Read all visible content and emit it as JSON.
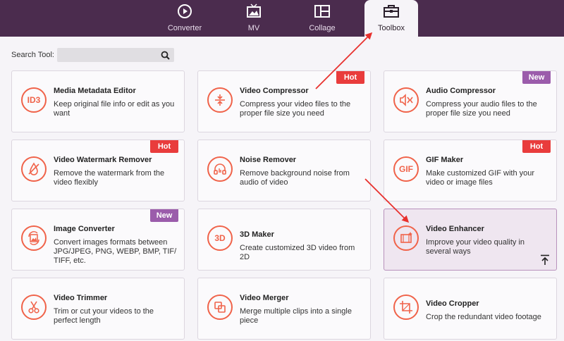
{
  "nav": {
    "tabs": [
      {
        "label": "Converter",
        "icon": "play-circle-icon"
      },
      {
        "label": "MV",
        "icon": "tv-image-icon"
      },
      {
        "label": "Collage",
        "icon": "collage-layout-icon"
      },
      {
        "label": "Toolbox",
        "icon": "toolbox-icon",
        "active": true
      }
    ]
  },
  "search": {
    "label": "Search Tool:",
    "value": "",
    "placeholder": ""
  },
  "tools": [
    {
      "title": "Media Metadata Editor",
      "desc": "Keep original file info or edit as you want",
      "icon_text": "ID3"
    },
    {
      "title": "Video Compressor",
      "desc": "Compress your video files to the proper file size you need",
      "badge": "Hot"
    },
    {
      "title": "Audio Compressor",
      "desc": "Compress your audio files to the proper file size you need",
      "badge": "New"
    },
    {
      "title": "Video Watermark Remover",
      "desc": "Remove the watermark from the video flexibly",
      "badge": "Hot"
    },
    {
      "title": "Noise Remover",
      "desc": "Remove background noise from audio of video"
    },
    {
      "title": "GIF Maker",
      "desc": "Make customized GIF with your video or image files",
      "badge": "Hot",
      "icon_text": "GIF"
    },
    {
      "title": "Image Converter",
      "desc": "Convert images formats between JPG/JPEG, PNG, WEBP, BMP, TIF/ TIFF, etc.",
      "badge": "New"
    },
    {
      "title": "3D Maker",
      "desc": "Create customized 3D video from 2D",
      "icon_text": "3D"
    },
    {
      "title": "Video Enhancer",
      "desc": "Improve your video quality in several ways"
    },
    {
      "title": "Video Trimmer",
      "desc": "Trim or cut your videos to the perfect length"
    },
    {
      "title": "Video Merger",
      "desc": "Merge multiple clips into a single piece"
    },
    {
      "title": "Video Cropper",
      "desc": "Crop the redundant video footage"
    }
  ],
  "colors": {
    "header_bg": "#4b2c4e",
    "accent": "#f0634a",
    "hot": "#e93c3c",
    "new": "#9b5cab",
    "arrow": "#e8302d"
  }
}
